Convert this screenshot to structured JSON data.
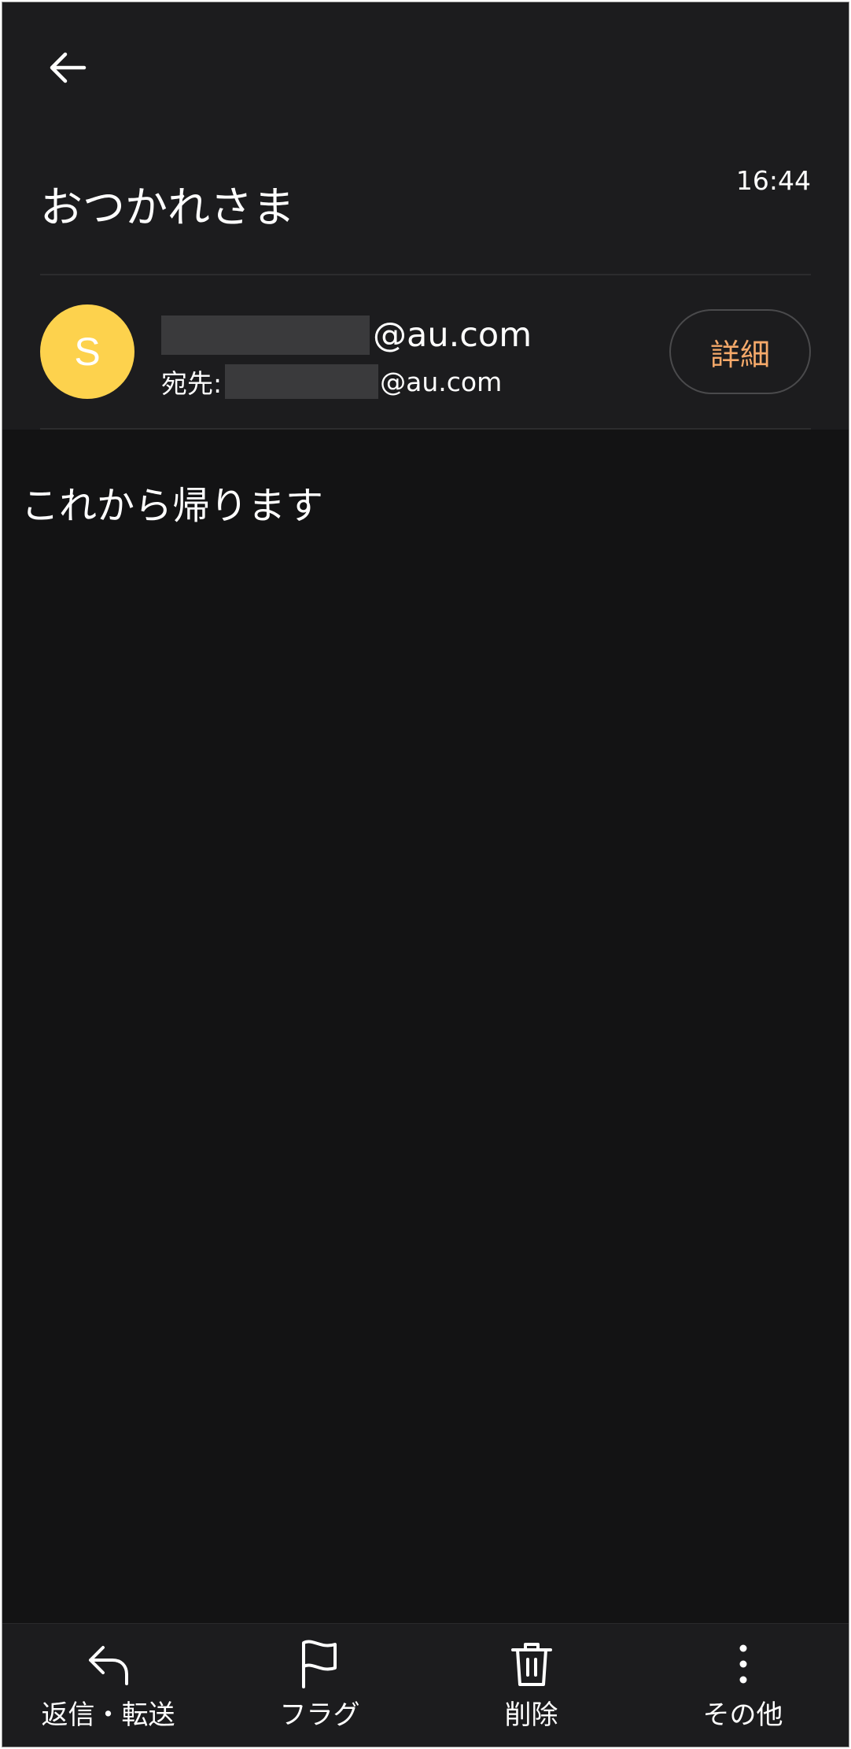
{
  "header": {
    "back_icon": "arrow-left-icon",
    "subject": "おつかれさま",
    "time": "16:44"
  },
  "sender": {
    "avatar_letter": "S",
    "avatar_color": "#fdd24d",
    "from_domain": "@au.com",
    "to_label": "宛先:",
    "to_domain": "@au.com",
    "detail_button": "詳細",
    "detail_color": "#f5a96a"
  },
  "message": {
    "body": "これから帰ります"
  },
  "toolbar": {
    "items": [
      {
        "label": "返信・転送",
        "icon": "reply-icon"
      },
      {
        "label": "フラグ",
        "icon": "flag-icon"
      },
      {
        "label": "削除",
        "icon": "trash-icon"
      },
      {
        "label": "その他",
        "icon": "more-vertical-icon"
      }
    ]
  }
}
